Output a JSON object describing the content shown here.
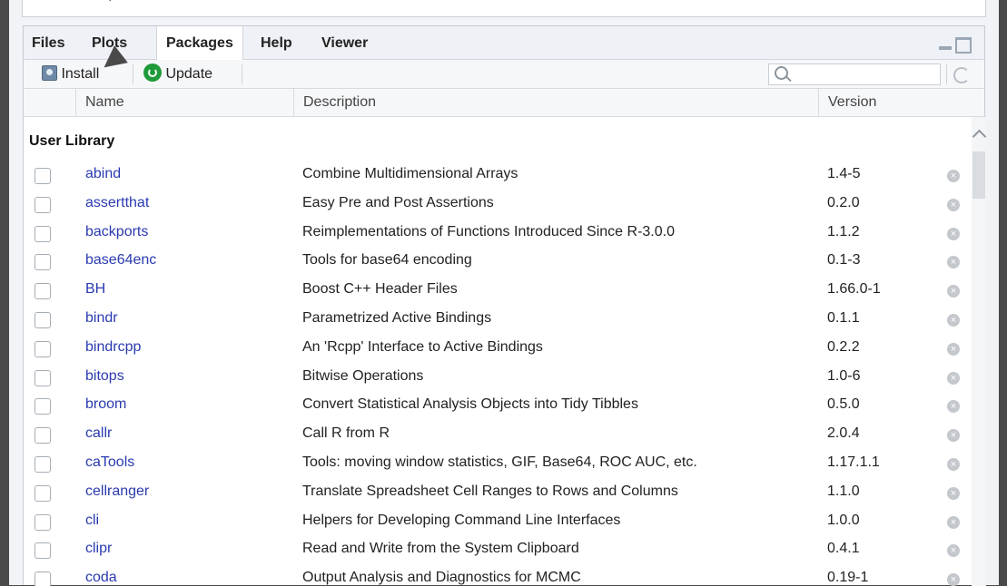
{
  "tabs": [
    {
      "label": "Files"
    },
    {
      "label": "Plots"
    },
    {
      "label": "Packages"
    },
    {
      "label": "Help"
    },
    {
      "label": "Viewer"
    }
  ],
  "toolbar": {
    "install_label": "Install",
    "update_label": "Update",
    "search_placeholder": ""
  },
  "columns": {
    "name": "Name",
    "description": "Description",
    "version": "Version"
  },
  "group_title": "User Library",
  "packages": [
    {
      "name": "abind",
      "description": "Combine Multidimensional Arrays",
      "version": "1.4-5"
    },
    {
      "name": "assertthat",
      "description": "Easy Pre and Post Assertions",
      "version": "0.2.0"
    },
    {
      "name": "backports",
      "description": "Reimplementations of Functions Introduced Since R-3.0.0",
      "version": "1.1.2"
    },
    {
      "name": "base64enc",
      "description": "Tools for base64 encoding",
      "version": "0.1-3"
    },
    {
      "name": "BH",
      "description": "Boost C++ Header Files",
      "version": "1.66.0-1"
    },
    {
      "name": "bindr",
      "description": "Parametrized Active Bindings",
      "version": "0.1.1"
    },
    {
      "name": "bindrcpp",
      "description": "An 'Rcpp' Interface to Active Bindings",
      "version": "0.2.2"
    },
    {
      "name": "bitops",
      "description": "Bitwise Operations",
      "version": "1.0-6"
    },
    {
      "name": "broom",
      "description": "Convert Statistical Analysis Objects into Tidy Tibbles",
      "version": "0.5.0"
    },
    {
      "name": "callr",
      "description": "Call R from R",
      "version": "2.0.4"
    },
    {
      "name": "caTools",
      "description": "Tools: moving window statistics, GIF, Base64, ROC AUC, etc.",
      "version": "1.17.1.1"
    },
    {
      "name": "cellranger",
      "description": "Translate Spreadsheet Cell Ranges to Rows and Columns",
      "version": "1.1.0"
    },
    {
      "name": "cli",
      "description": "Helpers for Developing Command Line Interfaces",
      "version": "1.0.0"
    },
    {
      "name": "clipr",
      "description": "Read and Write from the System Clipboard",
      "version": "0.4.1"
    },
    {
      "name": "coda",
      "description": "Output Analysis and Diagnostics for MCMC",
      "version": "0.19-1"
    }
  ]
}
